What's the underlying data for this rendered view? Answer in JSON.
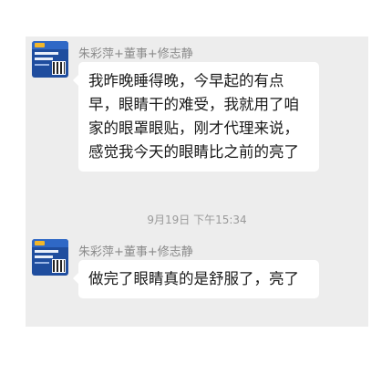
{
  "messages": [
    {
      "sender": "朱彩萍+董事+修志静",
      "text": "我昨晚睡得晚，今早起的有点早，眼睛干的难受，我就用了咱家的眼罩眼贴，刚才代理来说，感觉我今天的眼睛比之前的亮了"
    },
    {
      "sender": "朱彩萍+董事+修志静",
      "text": "做完了眼睛真的是舒服了，亮了"
    }
  ],
  "timestamp": "9月19日 下午15:34",
  "avatar": {
    "icon": "poster-avatar-icon",
    "colors": {
      "base": "#1f4d9e",
      "accent": "#f2b62a"
    }
  }
}
